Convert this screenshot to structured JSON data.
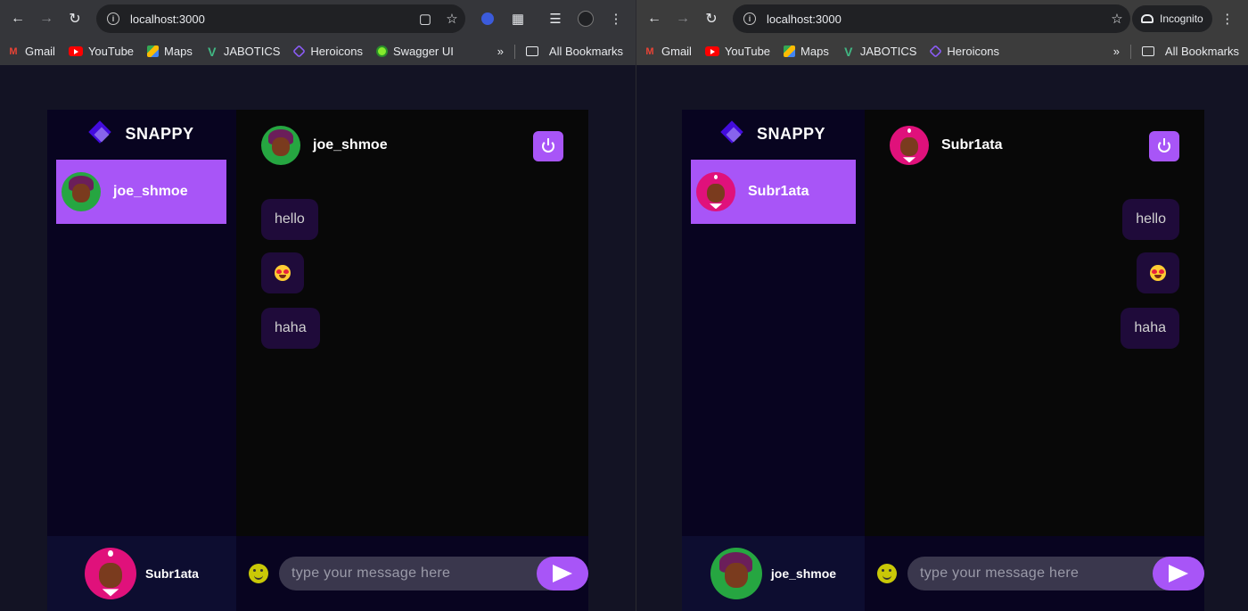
{
  "left_window": {
    "url": "localhost:3000",
    "bookmarks": [
      "Gmail",
      "YouTube",
      "Maps",
      "JABOTICS",
      "Heroicons",
      "Swagger UI"
    ],
    "more": "»",
    "all_bookmarks": "All Bookmarks",
    "brand": "SNAPPY",
    "contact_name": "joe_shmoe",
    "chat_header_name": "joe_shmoe",
    "messages": [
      "hello",
      "😍",
      "haha"
    ],
    "current_user": "Subr1ata",
    "input_placeholder": "type your message here"
  },
  "right_window": {
    "url": "localhost:3000",
    "incognito_label": "Incognito",
    "bookmarks": [
      "Gmail",
      "YouTube",
      "Maps",
      "JABOTICS",
      "Heroicons"
    ],
    "more": "»",
    "all_bookmarks": "All Bookmarks",
    "brand": "SNAPPY",
    "contact_name": "Subr1ata",
    "chat_header_name": "Subr1ata",
    "messages": [
      "hello",
      "😍",
      "haha"
    ],
    "current_user": "joe_shmoe",
    "input_placeholder": "type your message here"
  },
  "colors": {
    "accent": "#a855f7",
    "background": "#131324",
    "sidebar": "#080420",
    "message_bubble": "#1f0b3a"
  },
  "icons": {
    "back": "arrow-left-icon",
    "forward": "arrow-right-icon",
    "reload": "reload-icon",
    "site_info": "info-icon",
    "bookmark_star": "star-icon",
    "logout": "power-icon",
    "emoji": "smiley-icon",
    "send": "send-icon"
  }
}
